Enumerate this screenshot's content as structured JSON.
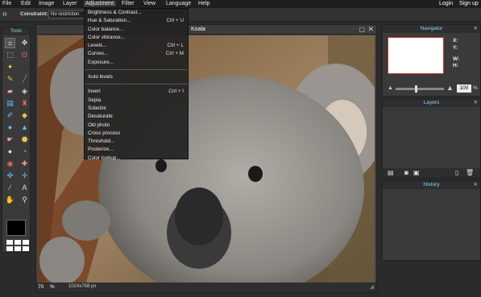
{
  "menubar": {
    "items": [
      "File",
      "Edit",
      "Image",
      "Layer",
      "Adjustment",
      "Filter",
      "View",
      "Language",
      "Help"
    ],
    "login": "Login",
    "signup": "Sign up"
  },
  "options": {
    "constraint_label": "Constraint:",
    "constraint_value": "No restriction"
  },
  "tools": {
    "title": "Tools"
  },
  "image_window": {
    "title": "Koala",
    "zoom": "70",
    "zoom_unit": "%",
    "dimensions": "1024x768 px"
  },
  "adjustment_menu": {
    "items": [
      {
        "label": "Brightness & Contrast...",
        "shortcut": ""
      },
      {
        "label": "Hue & Saturation...",
        "shortcut": "Ctrl + U"
      },
      {
        "label": "Color balance...",
        "shortcut": ""
      },
      {
        "label": "Color vibrance...",
        "shortcut": ""
      },
      {
        "label": "Levels...",
        "shortcut": "Ctrl + L"
      },
      {
        "label": "Curves...",
        "shortcut": "Ctrl + M"
      },
      {
        "label": "Exposure...",
        "shortcut": ""
      },
      {
        "label": "Auto levels",
        "shortcut": ""
      },
      {
        "label": "Invert",
        "shortcut": "Ctrl + I"
      },
      {
        "label": "Sepia",
        "shortcut": ""
      },
      {
        "label": "Solarize",
        "shortcut": ""
      },
      {
        "label": "Desaturate",
        "shortcut": ""
      },
      {
        "label": "Old photo",
        "shortcut": ""
      },
      {
        "label": "Cross process",
        "shortcut": ""
      },
      {
        "label": "Threshold...",
        "shortcut": ""
      },
      {
        "label": "Posterize...",
        "shortcut": ""
      },
      {
        "label": "Color lookup...",
        "shortcut": ""
      }
    ]
  },
  "navigator": {
    "title": "Navigator",
    "x_label": "X:",
    "y_label": "Y:",
    "w_label": "W:",
    "h_label": "H:",
    "zoom": "100",
    "zoom_unit": "%"
  },
  "layers": {
    "title": "Layers"
  },
  "history": {
    "title": "History"
  },
  "colors": {
    "accent": "#8bd2ff",
    "menubar_bg": "#1f1f1f",
    "panel_bg": "#3a3a3a",
    "primary_color": "#000000"
  }
}
